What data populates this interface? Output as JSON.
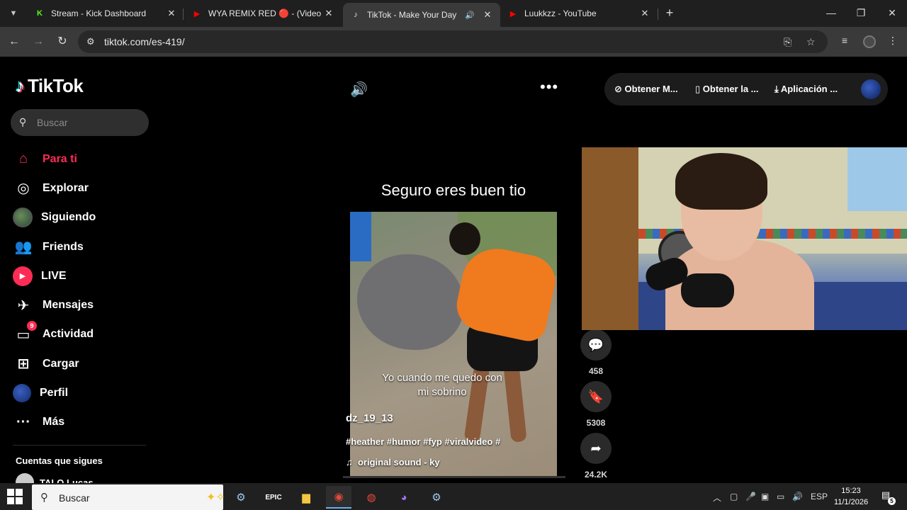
{
  "browser": {
    "tabs": [
      {
        "title": "Stream - Kick Dashboard",
        "favicon": "kick-icon",
        "favicon_color": "#53fc18"
      },
      {
        "title": "WYA REMIX RED 🔴 - (Video O",
        "favicon": "youtube-icon",
        "favicon_color": "#ff0000"
      },
      {
        "title": "TikTok - Make Your Day",
        "favicon": "tiktok-icon",
        "favicon_color": "#ffffff",
        "active": true,
        "audio": true
      },
      {
        "title": "Luukkzz - YouTube",
        "favicon": "youtube-icon",
        "favicon_color": "#ff0000"
      }
    ],
    "url": "tiktok.com/es-419/"
  },
  "tiktok": {
    "logo_text": "TikTok",
    "search_placeholder": "Buscar",
    "menu": [
      {
        "label": "Para ti",
        "icon": "home-icon",
        "active": true
      },
      {
        "label": "Explorar",
        "icon": "compass-icon"
      },
      {
        "label": "Siguiendo",
        "icon": "following-avatar-icon"
      },
      {
        "label": "Friends",
        "icon": "friends-icon"
      },
      {
        "label": "LIVE",
        "icon": "live-icon"
      },
      {
        "label": "Mensajes",
        "icon": "messages-icon"
      },
      {
        "label": "Actividad",
        "icon": "activity-icon",
        "badge": "9"
      },
      {
        "label": "Cargar",
        "icon": "upload-icon"
      },
      {
        "label": "Perfil",
        "icon": "profile-icon"
      },
      {
        "label": "Más",
        "icon": "more-icon"
      }
    ],
    "following_header": "Cuentas que sigues",
    "following": [
      {
        "name": "TALO Lucas"
      }
    ],
    "topbar": {
      "get_coins": "Obtener M...",
      "get_app": "Obtener la ...",
      "desktop_app": "Aplicación ..."
    },
    "video": {
      "title": "Seguro eres buen tio",
      "caption_line1": "Yo cuando me quedo con",
      "caption_line2": "mi sobrino",
      "author": "dz_19_13",
      "hashtags": "#heather #humor #fyp #viralvideo #",
      "sound": "original sound - ky"
    },
    "actions": [
      {
        "icon": "comment-icon",
        "count": "458"
      },
      {
        "icon": "bookmark-icon",
        "count": "5308"
      },
      {
        "icon": "share-icon",
        "count": "24.2K"
      }
    ]
  },
  "taskbar": {
    "search_placeholder": "Buscar",
    "language": "ESP",
    "time": "15:23",
    "date": "11/1/2026",
    "notifications": "5"
  }
}
